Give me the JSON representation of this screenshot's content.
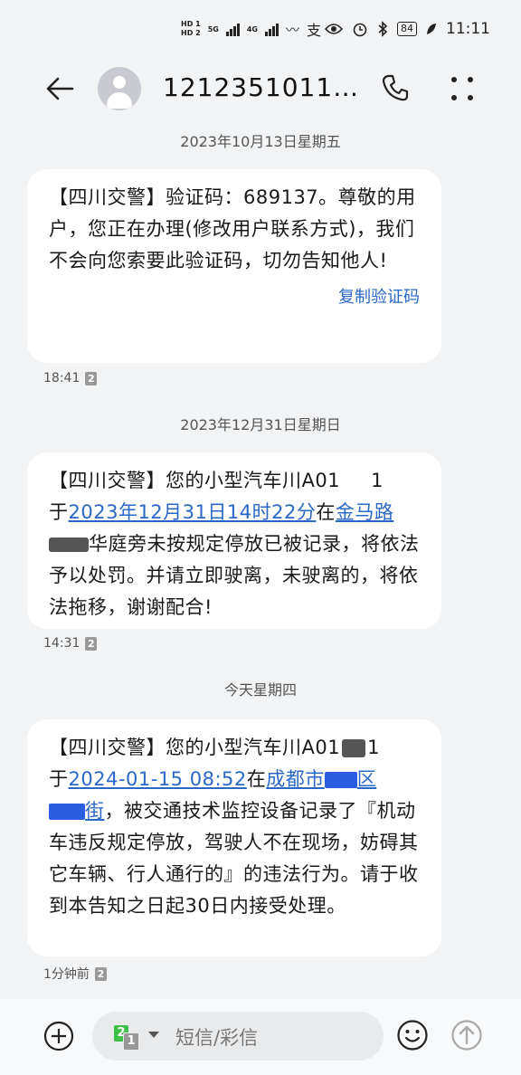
{
  "status": {
    "hd1": "HD 1",
    "hd2": "HD 2",
    "net1": "5G",
    "net2": "4G",
    "battery": "84",
    "time": "11:11",
    "icons": [
      "signal-icon",
      "wifi-icon",
      "alipay-icon",
      "eye-icon",
      "alarm-icon",
      "bluetooth-icon",
      "battery-icon",
      "leaf-icon"
    ]
  },
  "header": {
    "title": "1212351011…",
    "icons": [
      "back-arrow-icon",
      "avatar-icon",
      "phone-icon",
      "more-icon"
    ]
  },
  "thread": {
    "date1": "2023年10月13日星期五",
    "msg1_text": "【四川交警】验证码：689137。尊敬的用户，您正在办理(修改用户联系方式)，我们不会向您索要此验证码，切勿告知他人!",
    "msg1_copy": "复制验证码",
    "msg1_time": "18:41",
    "sim_badge": "2",
    "date2": "2023年12月31日星期日",
    "msg2_p1": "【四川交警】您的小型汽车川A01",
    "msg2_p2": "1",
    "msg2_p3": "于",
    "msg2_link1": "2023年12月31日14时22分",
    "msg2_p4": "在",
    "msg2_link2": "金马路",
    "msg2_p5": "华庭旁未按规定停放已被记录，将依法予以处罚。并请立即驶离，未驶离的，将依法拖移，谢谢配合!",
    "msg2_time": "14:31",
    "date3": "今天星期四",
    "msg3_p1": "【四川交警】您的小型汽车川A01",
    "msg3_p2": "1",
    "msg3_p3": "于",
    "msg3_link1": "2024-01-15 08:52",
    "msg3_p4": "在",
    "msg3_link2a": "成都市",
    "msg3_link2b": "区",
    "msg3_link3": "街",
    "msg3_p5": "，被交通技术监控设备记录了『机动车违反规定停放，驾驶人不在现场，妨碍其它车辆、行人通行的』的违法行为。请于收到本告知之日起30日内接受处理。",
    "msg3_time": "1分钟前"
  },
  "composer": {
    "sim_main": "2",
    "sim_alt": "1",
    "placeholder": "短信/彩信",
    "icons": [
      "add-icon",
      "sim-select-icon",
      "emoji-icon",
      "send-icon"
    ]
  },
  "colors": {
    "link": "#2a68c8",
    "background": "#f1f3f5",
    "bubble": "#ffffff",
    "sim_green": "#3fbf4a"
  }
}
